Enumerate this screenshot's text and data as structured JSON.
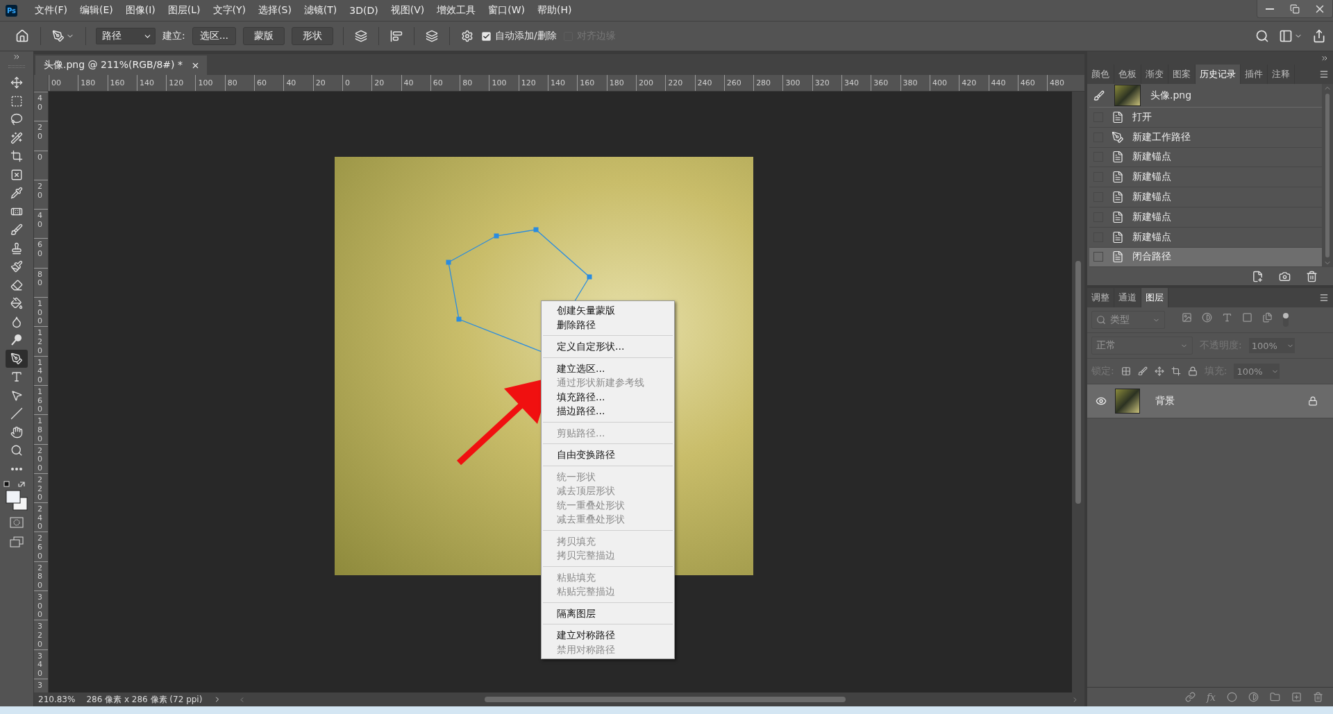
{
  "app_logo": "Ps",
  "menu_bar": [
    "文件(F)",
    "编辑(E)",
    "图像(I)",
    "图层(L)",
    "文字(Y)",
    "选择(S)",
    "滤镜(T)",
    "3D(D)",
    "视图(V)",
    "增效工具",
    "窗口(W)",
    "帮助(H)"
  ],
  "options_bar": {
    "path_mode": "路径",
    "make_label": "建立:",
    "make_buttons": [
      "选区...",
      "蒙版",
      "形状"
    ],
    "auto_add_delete": {
      "label": "自动添加/删除",
      "checked": true,
      "disabled": false
    },
    "align_edges": {
      "label": "对齐边缘",
      "checked": false,
      "disabled": true
    }
  },
  "document_tab": {
    "title": "头像.png @ 211%(RGB/8#) *"
  },
  "rulers": {
    "horizontal": [
      "00",
      "180",
      "160",
      "140",
      "120",
      "100",
      "80",
      "60",
      "40",
      "20",
      "0",
      "20",
      "40",
      "60",
      "80",
      "100",
      "120",
      "140",
      "160",
      "180",
      "200",
      "220",
      "240",
      "260",
      "280",
      "300",
      "320",
      "340",
      "360",
      "380",
      "400",
      "420",
      "440",
      "460",
      "480"
    ],
    "vertical": [
      "40",
      "20",
      "0",
      "20",
      "40",
      "60",
      "80",
      "100",
      "120",
      "140",
      "160",
      "180",
      "200",
      "220",
      "240",
      "260",
      "280",
      "300",
      "320",
      "340",
      "3"
    ]
  },
  "tools": [
    {
      "kind": "move",
      "selected": false
    },
    {
      "kind": "marquee",
      "selected": false
    },
    {
      "kind": "lasso",
      "selected": false
    },
    {
      "kind": "quick_select",
      "selected": false
    },
    {
      "kind": "crop",
      "selected": false
    },
    {
      "kind": "frame",
      "selected": false
    },
    {
      "kind": "eyedropper",
      "selected": false
    },
    {
      "kind": "healing",
      "selected": false
    },
    {
      "kind": "brush",
      "selected": false
    },
    {
      "kind": "stamp",
      "selected": false
    },
    {
      "kind": "history_brush",
      "selected": false
    },
    {
      "kind": "eraser",
      "selected": false
    },
    {
      "kind": "bucket",
      "selected": false
    },
    {
      "kind": "blur",
      "selected": false
    },
    {
      "kind": "dodge",
      "selected": false
    },
    {
      "kind": "pen",
      "selected": true
    },
    {
      "kind": "type",
      "selected": false
    },
    {
      "kind": "path_select",
      "selected": false
    },
    {
      "kind": "line",
      "selected": false
    },
    {
      "kind": "hand",
      "selected": false
    },
    {
      "kind": "zoom",
      "selected": false
    },
    {
      "kind": "more",
      "selected": false
    }
  ],
  "context_menu": [
    [
      {
        "label": "创建矢量蒙版",
        "disabled": false
      },
      {
        "label": "删除路径",
        "disabled": false
      }
    ],
    [
      {
        "label": "定义自定形状...",
        "disabled": false
      }
    ],
    [
      {
        "label": "建立选区...",
        "disabled": false
      },
      {
        "label": "通过形状新建参考线",
        "disabled": true
      },
      {
        "label": "填充路径...",
        "disabled": false
      },
      {
        "label": "描边路径...",
        "disabled": false
      }
    ],
    [
      {
        "label": "剪贴路径...",
        "disabled": true
      }
    ],
    [
      {
        "label": "自由变换路径",
        "disabled": false
      }
    ],
    [
      {
        "label": "统一形状",
        "disabled": true
      },
      {
        "label": "减去顶层形状",
        "disabled": true
      },
      {
        "label": "统一重叠处形状",
        "disabled": true
      },
      {
        "label": "减去重叠处形状",
        "disabled": true
      }
    ],
    [
      {
        "label": "拷贝填充",
        "disabled": true
      },
      {
        "label": "拷贝完整描边",
        "disabled": true
      }
    ],
    [
      {
        "label": "粘贴填充",
        "disabled": true
      },
      {
        "label": "粘贴完整描边",
        "disabled": true
      }
    ],
    [
      {
        "label": "隔离图层",
        "disabled": false
      }
    ],
    [
      {
        "label": "建立对称路径",
        "disabled": false
      },
      {
        "label": "禁用对称路径",
        "disabled": true
      }
    ]
  ],
  "right_panel": {
    "top_tabs": [
      {
        "label": "颜色",
        "selected": false
      },
      {
        "label": "色板",
        "selected": false
      },
      {
        "label": "渐变",
        "selected": false
      },
      {
        "label": "图案",
        "selected": false
      },
      {
        "label": "历史记录",
        "selected": true
      },
      {
        "label": "插件",
        "selected": false
      },
      {
        "label": "注释",
        "selected": false
      }
    ],
    "history": {
      "snapshot": "头像.png",
      "steps": [
        {
          "label": "打开",
          "kind": "document",
          "selected": false,
          "checked": false
        },
        {
          "label": "新建工作路径",
          "kind": "pen",
          "selected": false,
          "checked": false
        },
        {
          "label": "新建锚点",
          "kind": "document",
          "selected": false,
          "checked": false
        },
        {
          "label": "新建锚点",
          "kind": "document",
          "selected": false,
          "checked": false
        },
        {
          "label": "新建锚点",
          "kind": "document",
          "selected": false,
          "checked": false
        },
        {
          "label": "新建锚点",
          "kind": "document",
          "selected": false,
          "checked": false
        },
        {
          "label": "新建锚点",
          "kind": "document",
          "selected": false,
          "checked": false
        },
        {
          "label": "闭合路径",
          "kind": "document",
          "selected": true,
          "checked": false
        }
      ]
    },
    "layer_tabs": [
      {
        "label": "调整",
        "selected": false
      },
      {
        "label": "通道",
        "selected": false
      },
      {
        "label": "图层",
        "selected": true
      }
    ],
    "filter_kind": "类型",
    "blend_mode": "正常",
    "opacity": {
      "label": "不透明度:",
      "value": "100%"
    },
    "lock_label": "锁定:",
    "fill": {
      "label": "填充:",
      "value": "100%"
    },
    "layers": [
      {
        "name": "背景",
        "visible": true,
        "selected": true,
        "locked": true
      }
    ],
    "footer_fx": "fx"
  },
  "status_bar": {
    "zoom": "210.83%",
    "doc_info": "286 像素 x 286 像素 (72 ppi)"
  }
}
